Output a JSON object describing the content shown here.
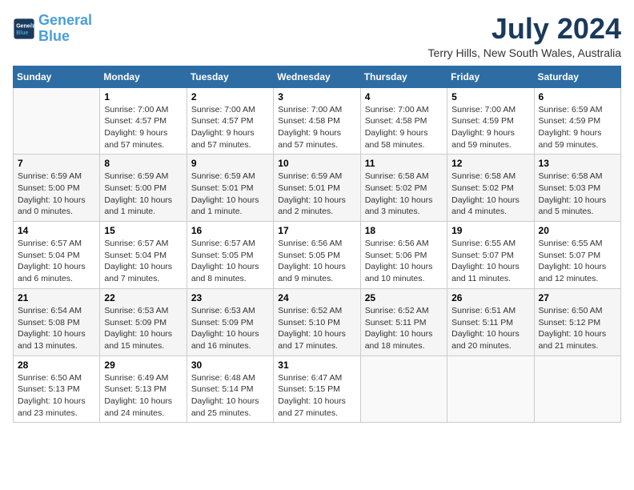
{
  "header": {
    "logo_line1": "General",
    "logo_line2": "Blue",
    "month_year": "July 2024",
    "location": "Terry Hills, New South Wales, Australia"
  },
  "days_of_week": [
    "Sunday",
    "Monday",
    "Tuesday",
    "Wednesday",
    "Thursday",
    "Friday",
    "Saturday"
  ],
  "weeks": [
    [
      {
        "day": "",
        "info": ""
      },
      {
        "day": "1",
        "info": "Sunrise: 7:00 AM\nSunset: 4:57 PM\nDaylight: 9 hours\nand 57 minutes."
      },
      {
        "day": "2",
        "info": "Sunrise: 7:00 AM\nSunset: 4:57 PM\nDaylight: 9 hours\nand 57 minutes."
      },
      {
        "day": "3",
        "info": "Sunrise: 7:00 AM\nSunset: 4:58 PM\nDaylight: 9 hours\nand 57 minutes."
      },
      {
        "day": "4",
        "info": "Sunrise: 7:00 AM\nSunset: 4:58 PM\nDaylight: 9 hours\nand 58 minutes."
      },
      {
        "day": "5",
        "info": "Sunrise: 7:00 AM\nSunset: 4:59 PM\nDaylight: 9 hours\nand 59 minutes."
      },
      {
        "day": "6",
        "info": "Sunrise: 6:59 AM\nSunset: 4:59 PM\nDaylight: 9 hours\nand 59 minutes."
      }
    ],
    [
      {
        "day": "7",
        "info": "Sunrise: 6:59 AM\nSunset: 5:00 PM\nDaylight: 10 hours\nand 0 minutes."
      },
      {
        "day": "8",
        "info": "Sunrise: 6:59 AM\nSunset: 5:00 PM\nDaylight: 10 hours\nand 1 minute."
      },
      {
        "day": "9",
        "info": "Sunrise: 6:59 AM\nSunset: 5:01 PM\nDaylight: 10 hours\nand 1 minute."
      },
      {
        "day": "10",
        "info": "Sunrise: 6:59 AM\nSunset: 5:01 PM\nDaylight: 10 hours\nand 2 minutes."
      },
      {
        "day": "11",
        "info": "Sunrise: 6:58 AM\nSunset: 5:02 PM\nDaylight: 10 hours\nand 3 minutes."
      },
      {
        "day": "12",
        "info": "Sunrise: 6:58 AM\nSunset: 5:02 PM\nDaylight: 10 hours\nand 4 minutes."
      },
      {
        "day": "13",
        "info": "Sunrise: 6:58 AM\nSunset: 5:03 PM\nDaylight: 10 hours\nand 5 minutes."
      }
    ],
    [
      {
        "day": "14",
        "info": "Sunrise: 6:57 AM\nSunset: 5:04 PM\nDaylight: 10 hours\nand 6 minutes."
      },
      {
        "day": "15",
        "info": "Sunrise: 6:57 AM\nSunset: 5:04 PM\nDaylight: 10 hours\nand 7 minutes."
      },
      {
        "day": "16",
        "info": "Sunrise: 6:57 AM\nSunset: 5:05 PM\nDaylight: 10 hours\nand 8 minutes."
      },
      {
        "day": "17",
        "info": "Sunrise: 6:56 AM\nSunset: 5:05 PM\nDaylight: 10 hours\nand 9 minutes."
      },
      {
        "day": "18",
        "info": "Sunrise: 6:56 AM\nSunset: 5:06 PM\nDaylight: 10 hours\nand 10 minutes."
      },
      {
        "day": "19",
        "info": "Sunrise: 6:55 AM\nSunset: 5:07 PM\nDaylight: 10 hours\nand 11 minutes."
      },
      {
        "day": "20",
        "info": "Sunrise: 6:55 AM\nSunset: 5:07 PM\nDaylight: 10 hours\nand 12 minutes."
      }
    ],
    [
      {
        "day": "21",
        "info": "Sunrise: 6:54 AM\nSunset: 5:08 PM\nDaylight: 10 hours\nand 13 minutes."
      },
      {
        "day": "22",
        "info": "Sunrise: 6:53 AM\nSunset: 5:09 PM\nDaylight: 10 hours\nand 15 minutes."
      },
      {
        "day": "23",
        "info": "Sunrise: 6:53 AM\nSunset: 5:09 PM\nDaylight: 10 hours\nand 16 minutes."
      },
      {
        "day": "24",
        "info": "Sunrise: 6:52 AM\nSunset: 5:10 PM\nDaylight: 10 hours\nand 17 minutes."
      },
      {
        "day": "25",
        "info": "Sunrise: 6:52 AM\nSunset: 5:11 PM\nDaylight: 10 hours\nand 18 minutes."
      },
      {
        "day": "26",
        "info": "Sunrise: 6:51 AM\nSunset: 5:11 PM\nDaylight: 10 hours\nand 20 minutes."
      },
      {
        "day": "27",
        "info": "Sunrise: 6:50 AM\nSunset: 5:12 PM\nDaylight: 10 hours\nand 21 minutes."
      }
    ],
    [
      {
        "day": "28",
        "info": "Sunrise: 6:50 AM\nSunset: 5:13 PM\nDaylight: 10 hours\nand 23 minutes."
      },
      {
        "day": "29",
        "info": "Sunrise: 6:49 AM\nSunset: 5:13 PM\nDaylight: 10 hours\nand 24 minutes."
      },
      {
        "day": "30",
        "info": "Sunrise: 6:48 AM\nSunset: 5:14 PM\nDaylight: 10 hours\nand 25 minutes."
      },
      {
        "day": "31",
        "info": "Sunrise: 6:47 AM\nSunset: 5:15 PM\nDaylight: 10 hours\nand 27 minutes."
      },
      {
        "day": "",
        "info": ""
      },
      {
        "day": "",
        "info": ""
      },
      {
        "day": "",
        "info": ""
      }
    ]
  ]
}
